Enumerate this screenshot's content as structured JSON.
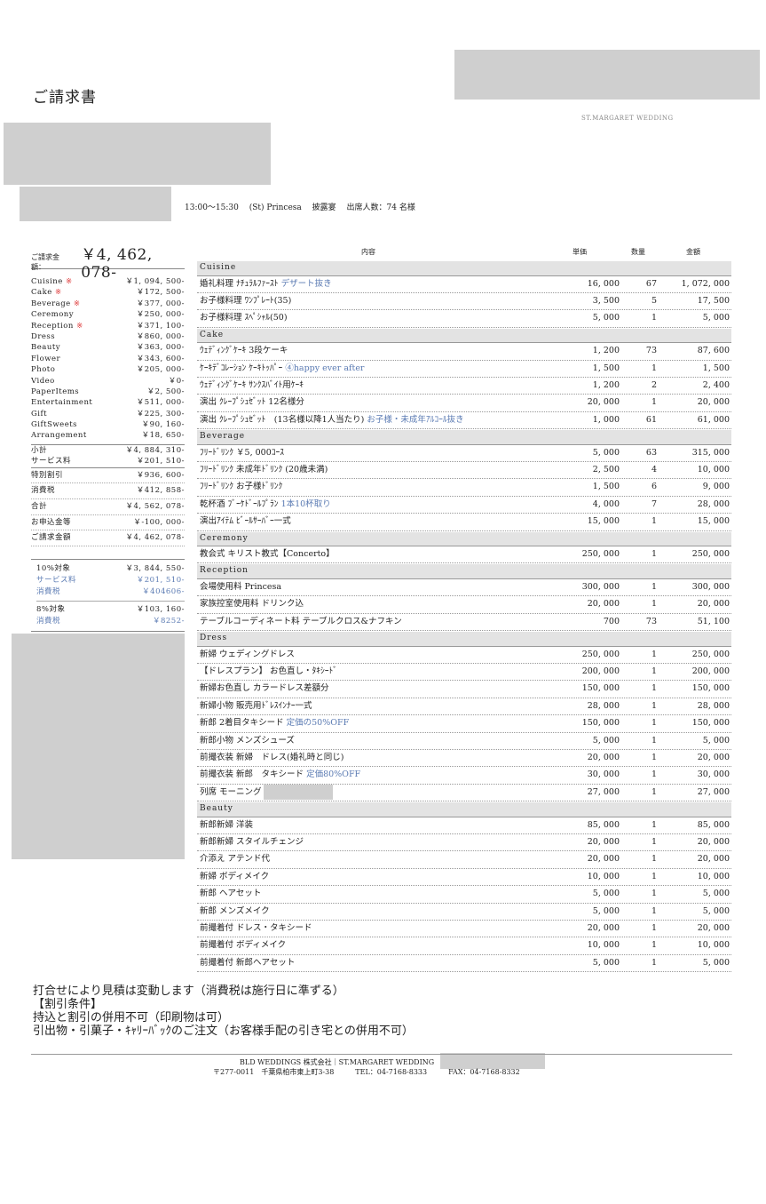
{
  "header": {
    "title": "ご請求書",
    "brand": "ST.MARGARET WEDDING",
    "event_info": "13:00〜15:30　 (St) Princesa　 披露宴　 出席人数：74 名様"
  },
  "summary": {
    "total_label": "ご請求金額：",
    "total_amount": "￥4, 462, 078-",
    "categories": [
      {
        "name": "Cuisine",
        "mark": "※",
        "amount": "￥1, 094, 500-"
      },
      {
        "name": "Cake",
        "mark": "※",
        "amount": "￥172, 500-"
      },
      {
        "name": "Beverage",
        "mark": "※",
        "amount": "￥377, 000-"
      },
      {
        "name": "Ceremony",
        "mark": "",
        "amount": "￥250, 000-"
      },
      {
        "name": "Reception",
        "mark": "※",
        "amount": "￥371, 100-"
      },
      {
        "name": "Dress",
        "mark": "",
        "amount": "￥860, 000-"
      },
      {
        "name": "Beauty",
        "mark": "",
        "amount": "￥363, 000-"
      },
      {
        "name": "Flower",
        "mark": "",
        "amount": "￥343, 600-"
      },
      {
        "name": "Photo",
        "mark": "",
        "amount": "￥205, 000-"
      },
      {
        "name": "Video",
        "mark": "",
        "amount": "￥0-"
      },
      {
        "name": "PaperItems",
        "mark": "",
        "amount": "￥2, 500-"
      },
      {
        "name": "Entertainment",
        "mark": "",
        "amount": "￥511, 000-"
      },
      {
        "name": "Gift",
        "mark": "",
        "amount": "￥225, 300-"
      },
      {
        "name": "GiftSweets",
        "mark": "",
        "amount": "￥90, 160-"
      },
      {
        "name": "Arrangement",
        "mark": "",
        "amount": "￥18, 650-"
      }
    ],
    "subtotal": {
      "label": "小計",
      "amount": "￥4, 884, 310-"
    },
    "service": {
      "label": "サービス料",
      "amount": "￥201, 510-"
    },
    "totals": [
      {
        "label": "特別割引",
        "amount": "￥936, 600-"
      },
      {
        "label": "消費税",
        "amount": "￥412, 858-"
      },
      {
        "label": "合計",
        "amount": "￥4, 562, 078-"
      },
      {
        "label": "お申込金等",
        "amount": "￥-100, 000-"
      },
      {
        "label": "ご請求金額",
        "amount": "￥4, 462, 078-"
      }
    ],
    "tax10": {
      "label": "10%対象",
      "amount": "￥3, 844, 550-",
      "service_label": "サービス料",
      "service_amount": "￥201, 510-",
      "tax_label": "消費税",
      "tax_amount": "￥404606-"
    },
    "tax8": {
      "label": "8%対象",
      "amount": "￥103, 160-",
      "tax_label": "消費税",
      "tax_amount": "￥8252-"
    }
  },
  "table": {
    "headers": {
      "name": "内容",
      "price": "単価",
      "qty": "数量",
      "amount": "金額"
    },
    "sections": [
      {
        "title": "Cuisine",
        "rows": [
          {
            "name": "婚礼料理 ﾅﾁｭﾗﾙﾌｧｰｽﾄ",
            "note": "デザート抜き",
            "price": "16, 000",
            "qty": "67",
            "amount": "1, 072, 000"
          },
          {
            "name": "お子様料理 ﾜﾝﾌﾟﾚｰﾄ(35)",
            "note": "",
            "price": "3, 500",
            "qty": "5",
            "amount": "17, 500"
          },
          {
            "name": "お子様料理 ｽﾍﾟｼｬﾙ(50)",
            "note": "",
            "price": "5, 000",
            "qty": "1",
            "amount": "5, 000"
          }
        ]
      },
      {
        "title": "Cake",
        "rows": [
          {
            "name": "ｳｪﾃﾞｨﾝｸﾞｹｰｷ 3段ケーキ",
            "note": "",
            "price": "1, 200",
            "qty": "73",
            "amount": "87, 600"
          },
          {
            "name": "ｹｰｷﾃﾞｺﾚｰｼｮﾝ ｹｰｷﾄｯﾊﾟｰ",
            "note": "④happy ever after",
            "price": "1, 500",
            "qty": "1",
            "amount": "1, 500"
          },
          {
            "name": "ｳｪﾃﾞｨﾝｸﾞｹｰｷ ｻﾝｸｽﾊﾞｲﾄ用ｹｰｷ",
            "note": "",
            "price": "1, 200",
            "qty": "2",
            "amount": "2, 400"
          },
          {
            "name": "演出 ｸﾚｰﾌﾟｼｭｾﾞｯﾄ 12名様分",
            "note": "",
            "price": "20, 000",
            "qty": "1",
            "amount": "20, 000"
          },
          {
            "name": "演出 ｸﾚｰﾌﾟｼｭｾﾞｯﾄ　(13名様以降1人当たり)",
            "note": "お子様・未成年ｱﾙｺｰﾙ抜き",
            "price": "1, 000",
            "qty": "61",
            "amount": "61, 000"
          }
        ]
      },
      {
        "title": "Beverage",
        "rows": [
          {
            "name": "ﾌﾘｰﾄﾞﾘﾝｸ ￥5, 000ｺｰｽ",
            "note": "",
            "price": "5, 000",
            "qty": "63",
            "amount": "315, 000"
          },
          {
            "name": "ﾌﾘｰﾄﾞﾘﾝｸ 未成年ﾄﾞﾘﾝｸ (20歳未満)",
            "note": "",
            "price": "2, 500",
            "qty": "4",
            "amount": "10, 000"
          },
          {
            "name": "ﾌﾘｰﾄﾞﾘﾝｸ お子様ﾄﾞﾘﾝｸ",
            "note": "",
            "price": "1, 500",
            "qty": "6",
            "amount": "9, 000"
          },
          {
            "name": "乾杯酒 ﾌﾞｰｹﾄﾞｰﾙﾌﾟﾗﾝ",
            "note": "1本10杯取り",
            "price": "4, 000",
            "qty": "7",
            "amount": "28, 000"
          },
          {
            "name": "演出ｱｲﾃﾑ ﾋﾞｰﾙｻｰﾊﾞｰ一式",
            "note": "",
            "price": "15, 000",
            "qty": "1",
            "amount": "15, 000"
          }
        ]
      },
      {
        "title": "Ceremony",
        "rows": [
          {
            "name": "教会式 キリスト教式【Concerto】",
            "note": "",
            "price": "250, 000",
            "qty": "1",
            "amount": "250, 000"
          }
        ]
      },
      {
        "title": "Reception",
        "rows": [
          {
            "name": "会場使用料 Princesa",
            "note": "",
            "price": "300, 000",
            "qty": "1",
            "amount": "300, 000"
          },
          {
            "name": "家族控室使用料 ドリンク込",
            "note": "",
            "price": "20, 000",
            "qty": "1",
            "amount": "20, 000"
          },
          {
            "name": "テーブルコーディネート料 テーブルクロス&ナフキン",
            "note": "",
            "price": "700",
            "qty": "73",
            "amount": "51, 100"
          }
        ]
      },
      {
        "title": "Dress",
        "rows": [
          {
            "name": "新婦 ウェディングドレス",
            "note": "",
            "price": "250, 000",
            "qty": "1",
            "amount": "250, 000"
          },
          {
            "name": "【ドレスプラン】 お色直し・ﾀｷｼｰﾄﾞ",
            "note": "",
            "price": "200, 000",
            "qty": "1",
            "amount": "200, 000"
          },
          {
            "name": "新婦お色直し カラードレス差額分",
            "note": "",
            "price": "150, 000",
            "qty": "1",
            "amount": "150, 000"
          },
          {
            "name": "新婦小物 販売用ﾄﾞﾚｽｲﾝﾅｰ一式",
            "note": "",
            "price": "28, 000",
            "qty": "1",
            "amount": "28, 000"
          },
          {
            "name": "新郎 2着目タキシード",
            "note": "定価の50%OFF",
            "price": "150, 000",
            "qty": "1",
            "amount": "150, 000"
          },
          {
            "name": "新郎小物 メンズシューズ",
            "note": "",
            "price": "5, 000",
            "qty": "1",
            "amount": "5, 000"
          },
          {
            "name": "前撮衣装 新婦　ドレス(婚礼時と同じ)",
            "note": "",
            "price": "20, 000",
            "qty": "1",
            "amount": "20, 000"
          },
          {
            "name": "前撮衣装 新郎　タキシード",
            "note": "定価80%OFF",
            "price": "30, 000",
            "qty": "1",
            "amount": "30, 000"
          },
          {
            "name": "列席 モーニング",
            "note": "",
            "price": "27, 000",
            "qty": "1",
            "amount": "27, 000"
          }
        ]
      },
      {
        "title": "Beauty",
        "rows": [
          {
            "name": "新郎新婦 洋装",
            "note": "",
            "price": "85, 000",
            "qty": "1",
            "amount": "85, 000"
          },
          {
            "name": "新郎新婦 スタイルチェンジ",
            "note": "",
            "price": "20, 000",
            "qty": "1",
            "amount": "20, 000"
          },
          {
            "name": "介添え アテンド代",
            "note": "",
            "price": "20, 000",
            "qty": "1",
            "amount": "20, 000"
          },
          {
            "name": "新婦 ボディメイク",
            "note": "",
            "price": "10, 000",
            "qty": "1",
            "amount": "10, 000"
          },
          {
            "name": "新郎 ヘアセット",
            "note": "",
            "price": "5, 000",
            "qty": "1",
            "amount": "5, 000"
          },
          {
            "name": "新郎 メンズメイク",
            "note": "",
            "price": "5, 000",
            "qty": "1",
            "amount": "5, 000"
          },
          {
            "name": "前撮着付 ドレス・タキシード",
            "note": "",
            "price": "20, 000",
            "qty": "1",
            "amount": "20, 000"
          },
          {
            "name": "前撮着付 ボディメイク",
            "note": "",
            "price": "10, 000",
            "qty": "1",
            "amount": "10, 000"
          },
          {
            "name": "前撮着付 新郎ヘアセット",
            "note": "",
            "price": "5, 000",
            "qty": "1",
            "amount": "5, 000"
          }
        ]
      }
    ]
  },
  "footnotes": [
    "打合せにより見積は変動します（消費税は施行日に準ずる）",
    "【割引条件】",
    "持込と割引の併用不可（印刷物は可）",
    "引出物・引菓子・ｷｬﾘｰﾊﾞｯｸのご注文（お客様手配の引き宅との併用不可）"
  ],
  "footer": {
    "company": "BLD WEDDINGS 株式会社｜ST.MARGARET WEDDING",
    "address": "〒277-0011　千葉県柏市東上町3-38　　　TEL：04-7168-8333　　　FAX：04-7168-8332"
  }
}
